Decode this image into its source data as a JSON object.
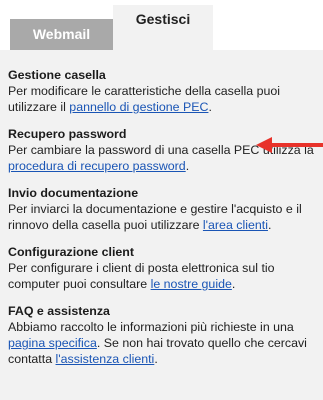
{
  "tabs": [
    {
      "label": "Webmail",
      "active": false
    },
    {
      "label": "Gestisci",
      "active": true
    }
  ],
  "sections": [
    {
      "title": "Gestione casella",
      "text_before": "Per modificare le caratteristiche della casella puoi utilizzare il ",
      "link": "pannello di gestione PEC",
      "text_after": "."
    },
    {
      "title": "Recupero password",
      "text_before": "Per cambiare la password di una casella PEC utilizza la ",
      "link": "procedura di recupero password",
      "text_after": "."
    },
    {
      "title": "Invio documentazione",
      "text_before": "Per inviarci la documentazione e gestire l'acquisto e il rinnovo della casella puoi utilizzare ",
      "link": "l'area clienti",
      "text_after": "."
    },
    {
      "title": "Configurazione client",
      "text_before": "Per configurare i client di posta elettronica sul tio computer puoi consultare ",
      "link": "le nostre guide",
      "text_after": "."
    },
    {
      "title": "FAQ e assistenza",
      "text_before": "Abbiamo raccolto le informazioni più richieste in una ",
      "link": "pagina specifica",
      "text_after": ". Se non hai trovato quello che cercavi contatta ",
      "link2": "l'assistenza clienti",
      "text_after2": "."
    }
  ],
  "colors": {
    "link": "#1a55b5",
    "arrow": "#e8322a",
    "tab_inactive": "#a9a9a9",
    "panel_bg": "#f2f2f2"
  },
  "annotation": {
    "icon": "red-arrow-icon"
  }
}
